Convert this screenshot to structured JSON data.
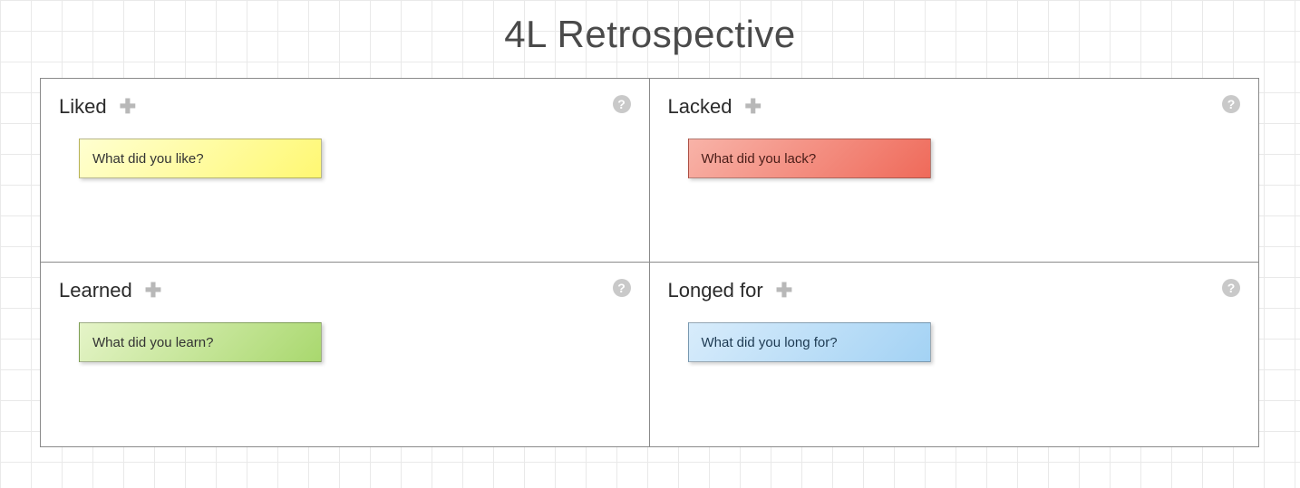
{
  "title": "4L Retrospective",
  "help_glyph": "?",
  "plus_glyph": "✚",
  "quadrants": {
    "liked": {
      "title": "Liked",
      "note": "What did you like?"
    },
    "lacked": {
      "title": "Lacked",
      "note": "What did you lack?"
    },
    "learned": {
      "title": "Learned",
      "note": "What did you learn?"
    },
    "longed_for": {
      "title": "Longed for",
      "note": "What did you long for?"
    }
  }
}
